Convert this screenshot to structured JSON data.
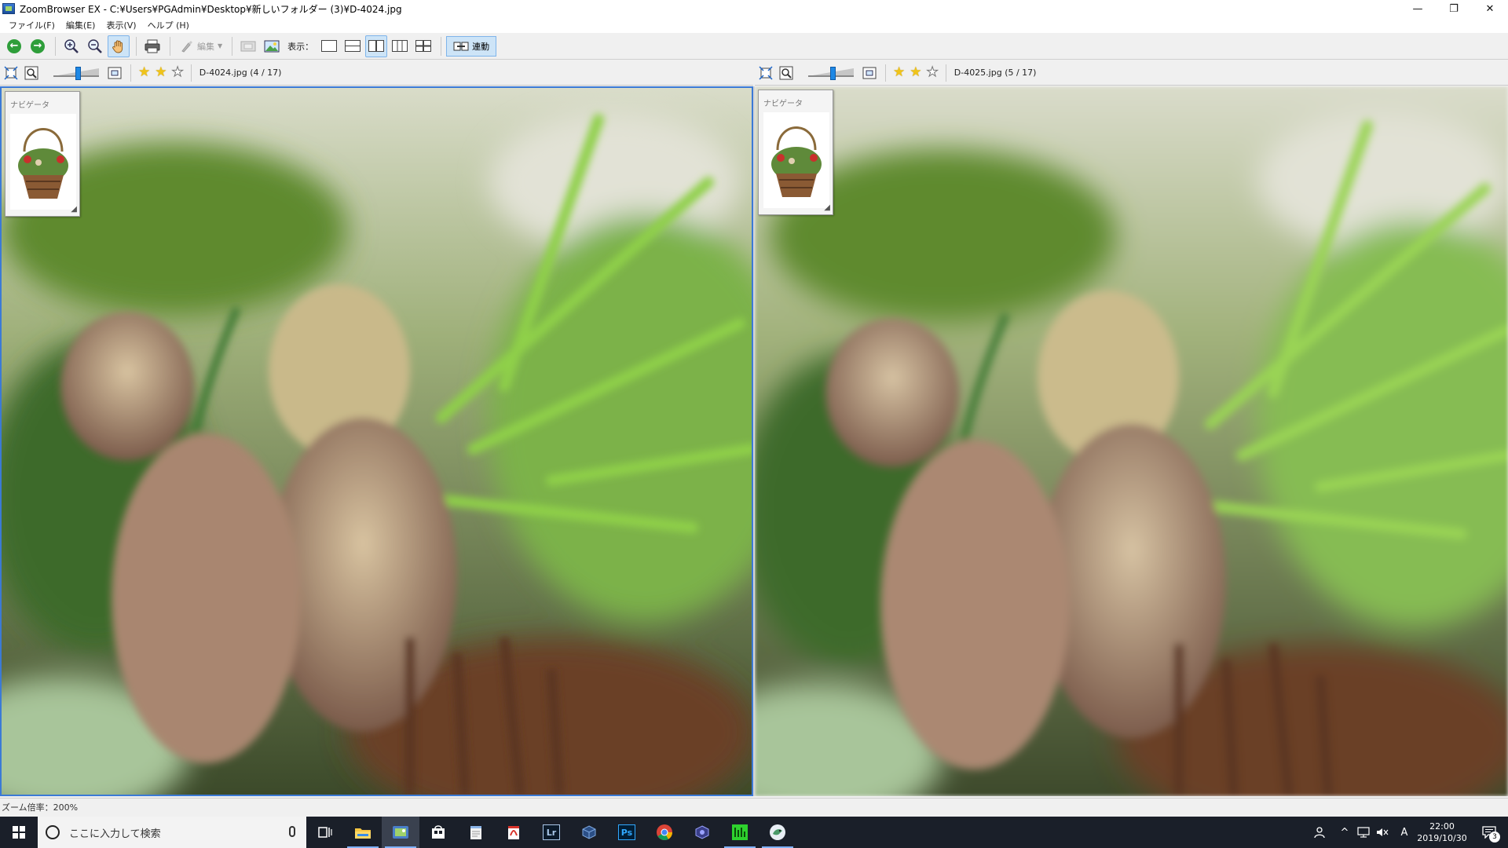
{
  "window": {
    "title": "ZoomBrowser EX - C:¥Users¥PGAdmin¥Desktop¥新しいフォルダー (3)¥D-4024.jpg",
    "minimize": "—",
    "maximize": "❐",
    "close": "✕"
  },
  "menu": {
    "items": [
      {
        "label": "ファイル(F)"
      },
      {
        "label": "編集(E)"
      },
      {
        "label": "表示(V)"
      },
      {
        "label": "ヘルプ (H)"
      }
    ]
  },
  "toolbar": {
    "edit_label": "編集",
    "view_label": "表示：",
    "link_label": "連動"
  },
  "panels": {
    "left": {
      "file_label": "D-4024.jpg (4 / 17)",
      "stars_on": 2,
      "stars_total": 3
    },
    "right": {
      "file_label": "D-4025.jpg (5 / 17)",
      "stars_on": 2,
      "stars_total": 3
    },
    "navigator_title": "ナビゲータ",
    "zoom_slider_fraction": 0.55
  },
  "status": {
    "zoom_text": "ズーム倍率：200%"
  },
  "taskbar": {
    "search_placeholder": "ここに入力して検索",
    "clock_time": "22:00",
    "clock_date": "2019/10/30",
    "ime_indicator": "A",
    "notification_count": "3",
    "apps": [
      {
        "name": "task-view"
      },
      {
        "name": "file-explorer"
      },
      {
        "name": "zoombrowser"
      },
      {
        "name": "store"
      },
      {
        "name": "notepad"
      },
      {
        "name": "pdf"
      },
      {
        "name": "lightroom",
        "label": "Lr"
      },
      {
        "name": "app-blue"
      },
      {
        "name": "photoshop",
        "label": "Ps"
      },
      {
        "name": "chrome"
      },
      {
        "name": "app-purple"
      },
      {
        "name": "app-green"
      },
      {
        "name": "app-bird"
      }
    ]
  },
  "colors": {
    "accent": "#3b7ad6",
    "taskbar": "#1a1f29",
    "toolbar_bg": "#f0f0f0"
  }
}
